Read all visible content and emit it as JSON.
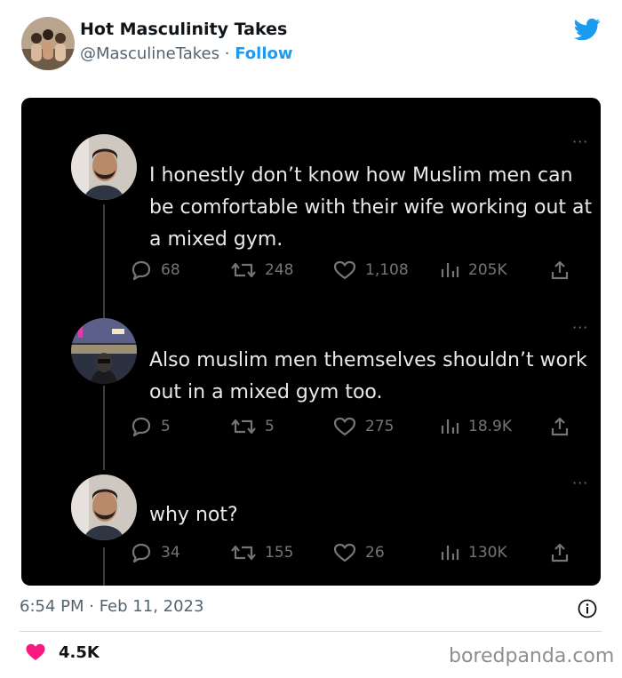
{
  "header": {
    "account_name": "Hot Masculinity Takes",
    "handle": "@MasculineTakes",
    "separator": "·",
    "follow_label": "Follow"
  },
  "thread": [
    {
      "text": "I honestly don’t know how Muslim men can be comfortable with their wife working out at a mixed gym.",
      "replies": "68",
      "retweets": "248",
      "likes": "1,108",
      "views": "205K"
    },
    {
      "text": "Also muslim men themselves shouldn’t work out in a mixed gym too.",
      "replies": "5",
      "retweets": "5",
      "likes": "275",
      "views": "18.9K"
    },
    {
      "text": "why not?",
      "replies": "34",
      "retweets": "155",
      "likes": "26",
      "views": "130K"
    }
  ],
  "more_glyph": "···",
  "footer": {
    "timestamp": "6:54 PM · Feb 11, 2023",
    "likes_count": "4.5K"
  },
  "watermark": "boredpanda.com",
  "colors": {
    "twitter_blue": "#1d9bf0",
    "heart_pink": "#f91880",
    "dark_bg": "#000000",
    "dark_text": "#e7e9ea",
    "dark_muted": "#71767b"
  },
  "icons": [
    "twitter-bird-icon",
    "more-icon",
    "reply-icon",
    "retweet-icon",
    "like-icon",
    "views-icon",
    "share-icon",
    "info-icon",
    "heart-icon"
  ]
}
